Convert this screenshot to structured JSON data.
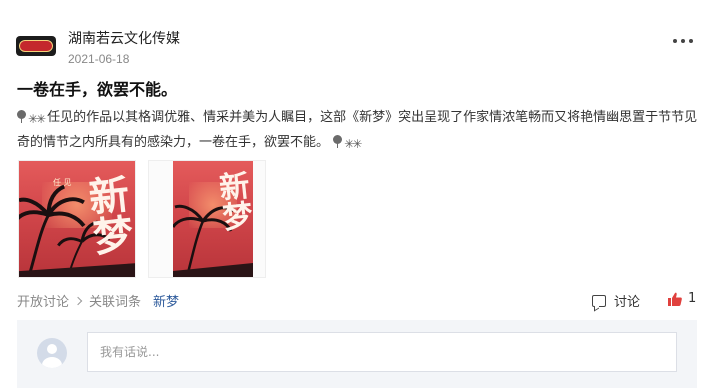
{
  "post": {
    "author": "湖南若云文化传媒",
    "date": "2021-06-18",
    "title": "一卷在手，欲罢不能。",
    "body_text": "任见的作品以其格调优雅、情采并美为人瞩目，这部《新梦》突出呈现了作家情浓笔畅而又将艳情幽思置于节节见奇的情节之内所具有的感染力，一卷在手，欲罢不能。",
    "body_emoji_lead": [
      "pin-icon",
      "palm-tree-icon"
    ],
    "body_emoji_tail": [
      "pin-icon",
      "palm-tree-icon"
    ],
    "images": [
      {
        "label": "任 见",
        "calligraphy": "新梦"
      },
      {
        "calligraphy": "新梦"
      }
    ]
  },
  "breadcrumb": {
    "items": [
      "开放讨论",
      "关联词条"
    ],
    "topic": "新梦"
  },
  "actions": {
    "comment_label": "讨论",
    "like_count": "1"
  },
  "comment_box": {
    "placeholder": "我有话说..."
  },
  "colors": {
    "topic_link": "#2d5a9b",
    "like": "#e0403d",
    "panel_bg": "#f3f5f8"
  }
}
